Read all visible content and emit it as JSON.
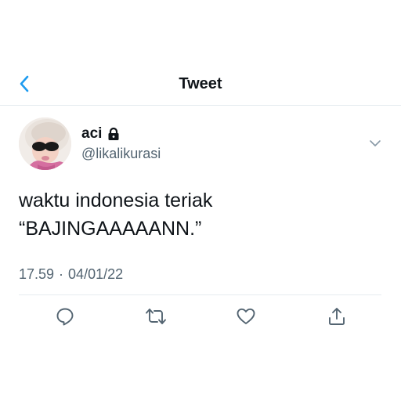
{
  "header": {
    "title": "Tweet"
  },
  "tweet": {
    "display_name": "aci",
    "handle": "@likalikurasi",
    "text_lines": [
      "waktu indonesia teriak",
      "“BAJINGAAAAANN.”"
    ],
    "time": "17.59",
    "separator": "·",
    "date": "04/01/22",
    "protected_icon": "lock-icon",
    "avatar_icon": "profile-photo"
  },
  "actions": [
    {
      "icon": "reply-icon"
    },
    {
      "icon": "retweet-icon"
    },
    {
      "icon": "like-icon"
    },
    {
      "icon": "share-icon"
    }
  ],
  "colors": {
    "accent": "#1d9bf0",
    "text": "#0f1419",
    "secondary": "#536471",
    "divider": "#e6ecf0"
  }
}
